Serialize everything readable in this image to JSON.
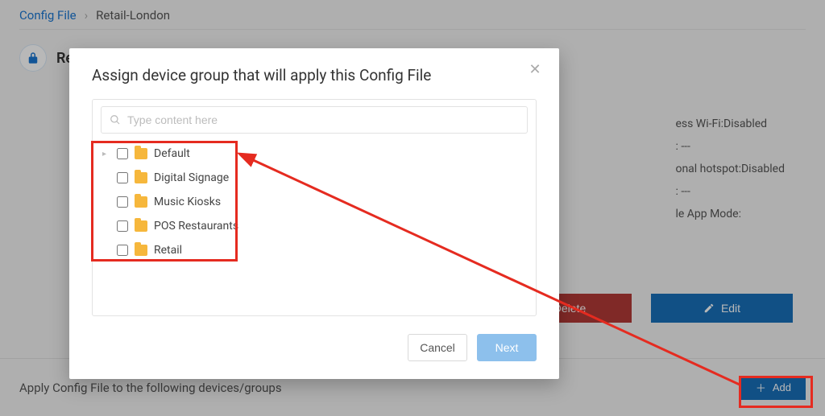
{
  "breadcrumb": {
    "root": "Config File",
    "current": "Retail-London"
  },
  "header": {
    "title_visible": "Ret"
  },
  "info": {
    "line1": "ess Wi-Fi:Disabled",
    "line2": ": ---",
    "line3": "onal hotspot:Disabled",
    "line4": ": ---",
    "line5": "le App Mode:"
  },
  "buttons": {
    "delete": "Delete",
    "edit": "Edit",
    "add": "Add"
  },
  "applybar": {
    "text": "Apply Config File to the following devices/groups"
  },
  "modal": {
    "title": "Assign device group that will apply this Config File",
    "search_placeholder": "Type content here",
    "cancel": "Cancel",
    "next": "Next",
    "items": [
      {
        "label": "Default",
        "has_children": true
      },
      {
        "label": "Digital Signage",
        "has_children": false
      },
      {
        "label": "Music Kiosks",
        "has_children": false
      },
      {
        "label": "POS Restaurants",
        "has_children": false
      },
      {
        "label": "Retail",
        "has_children": false
      }
    ]
  }
}
